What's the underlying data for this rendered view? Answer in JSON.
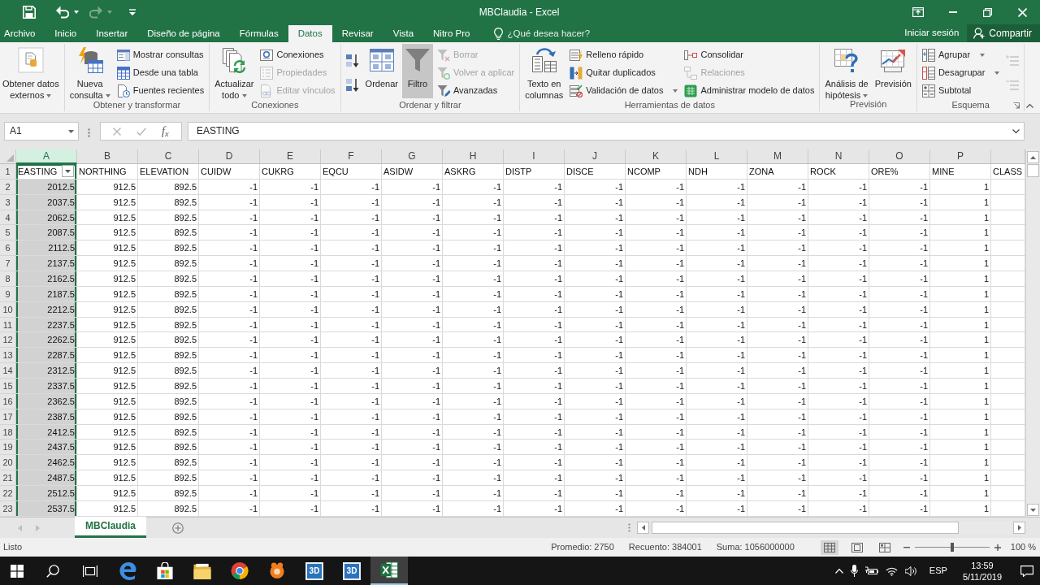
{
  "window": {
    "title": "MBClaudia - Excel"
  },
  "quick_access": [
    {
      "disabled": false
    },
    {
      "disabled": false
    },
    {
      "disabled": true
    },
    {
      "disabled": false
    }
  ],
  "tabs": [
    {
      "label": "Archivo",
      "selected": false
    },
    {
      "label": "Inicio",
      "selected": false
    },
    {
      "label": "Insertar",
      "selected": false
    },
    {
      "label": "Diseño de página",
      "selected": false
    },
    {
      "label": "Fórmulas",
      "selected": false
    },
    {
      "label": "Datos",
      "selected": true
    },
    {
      "label": "Revisar",
      "selected": false
    },
    {
      "label": "Vista",
      "selected": false
    },
    {
      "label": "Nitro Pro",
      "selected": false
    }
  ],
  "tell_me": {
    "placeholder": "¿Qué desea hacer?"
  },
  "account": {
    "sign_in": "Iniciar sesión",
    "share": "Compartir"
  },
  "ribbon": {
    "groups": [
      {
        "buttons": [
          {
            "kind": "large",
            "label": "Obtener datos\nexternos",
            "dropdown": true,
            "disabled": false,
            "selected": false
          }
        ]
      },
      {
        "label": "Obtener y transformar",
        "buttons": [
          {
            "kind": "large",
            "label": "Nueva\nconsulta",
            "dropdown": true,
            "disabled": false,
            "selected": false
          },
          {
            "kind": "small",
            "label": "Mostrar consultas",
            "dropdown": false,
            "disabled": false,
            "selected": false
          },
          {
            "kind": "small",
            "label": "Desde una tabla",
            "dropdown": false,
            "disabled": false,
            "selected": false
          },
          {
            "kind": "small",
            "label": "Fuentes recientes",
            "dropdown": false,
            "disabled": false,
            "selected": false
          }
        ]
      },
      {
        "label": "Conexiones",
        "buttons": [
          {
            "kind": "large",
            "label": "Actualizar\ntodo",
            "dropdown": true,
            "disabled": false,
            "selected": false
          },
          {
            "kind": "small",
            "label": "Conexiones",
            "dropdown": false,
            "disabled": false,
            "selected": false
          },
          {
            "kind": "small",
            "label": "Propiedades",
            "dropdown": false,
            "disabled": true,
            "selected": false
          },
          {
            "kind": "small",
            "label": "Editar vínculos",
            "dropdown": false,
            "disabled": true,
            "selected": false
          }
        ]
      },
      {
        "label": "Ordenar y filtrar",
        "buttons": [
          {
            "kind": "icon",
            "dropdown": false,
            "disabled": false,
            "selected": false
          },
          {
            "kind": "icon",
            "dropdown": false,
            "disabled": false,
            "selected": false
          },
          {
            "kind": "large",
            "label": "Ordenar",
            "dropdown": false,
            "disabled": false,
            "selected": false
          },
          {
            "kind": "large",
            "label": "Filtro",
            "dropdown": false,
            "disabled": false,
            "selected": true
          },
          {
            "kind": "small",
            "label": "Borrar",
            "dropdown": false,
            "disabled": true,
            "selected": false
          },
          {
            "kind": "small",
            "label": "Volver a aplicar",
            "dropdown": false,
            "disabled": true,
            "selected": false
          },
          {
            "kind": "small",
            "label": "Avanzadas",
            "dropdown": false,
            "disabled": false,
            "selected": false
          }
        ]
      },
      {
        "label": "Herramientas de datos",
        "buttons": [
          {
            "kind": "large",
            "label": "Texto en\ncolumnas",
            "dropdown": false,
            "disabled": false,
            "selected": false
          },
          {
            "kind": "small",
            "label": "Relleno rápido",
            "dropdown": false,
            "disabled": false,
            "selected": false
          },
          {
            "kind": "small",
            "label": "Quitar duplicados",
            "dropdown": false,
            "disabled": false,
            "selected": false
          },
          {
            "kind": "small",
            "label": "Validación de datos",
            "dropdown": true,
            "disabled": false,
            "selected": false
          },
          {
            "kind": "small",
            "label": "Consolidar",
            "dropdown": false,
            "disabled": false,
            "selected": false
          },
          {
            "kind": "small",
            "label": "Relaciones",
            "dropdown": false,
            "disabled": true,
            "selected": false
          },
          {
            "kind": "small",
            "label": "Administrar modelo de datos",
            "dropdown": false,
            "disabled": false,
            "selected": false
          }
        ]
      },
      {
        "label": "Previsión",
        "buttons": [
          {
            "kind": "large",
            "label": "Análisis de\nhipótesis",
            "dropdown": true,
            "disabled": false,
            "selected": false
          },
          {
            "kind": "large",
            "label": "Previsión",
            "dropdown": false,
            "disabled": false,
            "selected": false
          }
        ]
      },
      {
        "label": "Esquema",
        "launcher": true,
        "buttons": [
          {
            "kind": "small",
            "label": "Agrupar",
            "dropdown": true,
            "disabled": false,
            "selected": false
          },
          {
            "kind": "small",
            "label": "Desagrupar",
            "dropdown": true,
            "disabled": false,
            "selected": false
          },
          {
            "kind": "small",
            "label": "Subtotal",
            "dropdown": false,
            "disabled": false,
            "selected": false
          },
          {
            "kind": "icon",
            "dropdown": false,
            "disabled": true,
            "selected": false
          },
          {
            "kind": "icon",
            "dropdown": false,
            "disabled": true,
            "selected": false
          }
        ]
      }
    ]
  },
  "formula_bar": {
    "name_box": "A1",
    "insert_function": "f$_{x}$",
    "formula": "EASTING"
  },
  "sheet": {
    "columns": [
      {
        "letter": "A",
        "selected": true,
        "filter": true
      },
      {
        "letter": "B",
        "selected": false,
        "filter": false
      },
      {
        "letter": "C",
        "selected": false,
        "filter": false
      },
      {
        "letter": "D",
        "selected": false,
        "filter": false
      },
      {
        "letter": "E",
        "selected": false,
        "filter": false
      },
      {
        "letter": "F",
        "selected": false,
        "filter": false
      },
      {
        "letter": "G",
        "selected": false,
        "filter": false
      },
      {
        "letter": "H",
        "selected": false,
        "filter": false
      },
      {
        "letter": "I",
        "selected": false,
        "filter": false
      },
      {
        "letter": "J",
        "selected": false,
        "filter": false
      },
      {
        "letter": "K",
        "selected": false,
        "filter": false
      },
      {
        "letter": "L",
        "selected": false,
        "filter": false
      },
      {
        "letter": "M",
        "selected": false,
        "filter": false
      },
      {
        "letter": "N",
        "selected": false,
        "filter": false
      },
      {
        "letter": "O",
        "selected": false,
        "filter": false
      },
      {
        "letter": "P",
        "selected": false,
        "filter": false
      }
    ],
    "rows": [
      {
        "number": "1",
        "cells": [
          "EASTING",
          "NORTHING",
          "ELEVATION",
          "CUIDW",
          "CUKRG",
          "EQCU",
          "ASIDW",
          "ASKRG",
          "DISTP",
          "DISCE",
          "NCOMP",
          "NDH",
          "ZONA",
          "ROCK",
          "ORE%",
          "MINE",
          "CLASS"
        ]
      },
      {
        "number": "2",
        "cells": [
          "2012.5",
          "912.5",
          "892.5",
          "-1",
          "-1",
          "-1",
          "-1",
          "-1",
          "-1",
          "-1",
          "-1",
          "-1",
          "-1",
          "-1",
          "-1",
          "1"
        ]
      },
      {
        "number": "3",
        "cells": [
          "2037.5",
          "912.5",
          "892.5",
          "-1",
          "-1",
          "-1",
          "-1",
          "-1",
          "-1",
          "-1",
          "-1",
          "-1",
          "-1",
          "-1",
          "-1",
          "1"
        ]
      },
      {
        "number": "4",
        "cells": [
          "2062.5",
          "912.5",
          "892.5",
          "-1",
          "-1",
          "-1",
          "-1",
          "-1",
          "-1",
          "-1",
          "-1",
          "-1",
          "-1",
          "-1",
          "-1",
          "1"
        ]
      },
      {
        "number": "5",
        "cells": [
          "2087.5",
          "912.5",
          "892.5",
          "-1",
          "-1",
          "-1",
          "-1",
          "-1",
          "-1",
          "-1",
          "-1",
          "-1",
          "-1",
          "-1",
          "-1",
          "1"
        ]
      },
      {
        "number": "6",
        "cells": [
          "2112.5",
          "912.5",
          "892.5",
          "-1",
          "-1",
          "-1",
          "-1",
          "-1",
          "-1",
          "-1",
          "-1",
          "-1",
          "-1",
          "-1",
          "-1",
          "1"
        ]
      },
      {
        "number": "7",
        "cells": [
          "2137.5",
          "912.5",
          "892.5",
          "-1",
          "-1",
          "-1",
          "-1",
          "-1",
          "-1",
          "-1",
          "-1",
          "-1",
          "-1",
          "-1",
          "-1",
          "1"
        ]
      },
      {
        "number": "8",
        "cells": [
          "2162.5",
          "912.5",
          "892.5",
          "-1",
          "-1",
          "-1",
          "-1",
          "-1",
          "-1",
          "-1",
          "-1",
          "-1",
          "-1",
          "-1",
          "-1",
          "1"
        ]
      },
      {
        "number": "9",
        "cells": [
          "2187.5",
          "912.5",
          "892.5",
          "-1",
          "-1",
          "-1",
          "-1",
          "-1",
          "-1",
          "-1",
          "-1",
          "-1",
          "-1",
          "-1",
          "-1",
          "1"
        ]
      },
      {
        "number": "10",
        "cells": [
          "2212.5",
          "912.5",
          "892.5",
          "-1",
          "-1",
          "-1",
          "-1",
          "-1",
          "-1",
          "-1",
          "-1",
          "-1",
          "-1",
          "-1",
          "-1",
          "1"
        ]
      },
      {
        "number": "11",
        "cells": [
          "2237.5",
          "912.5",
          "892.5",
          "-1",
          "-1",
          "-1",
          "-1",
          "-1",
          "-1",
          "-1",
          "-1",
          "-1",
          "-1",
          "-1",
          "-1",
          "1"
        ]
      },
      {
        "number": "12",
        "cells": [
          "2262.5",
          "912.5",
          "892.5",
          "-1",
          "-1",
          "-1",
          "-1",
          "-1",
          "-1",
          "-1",
          "-1",
          "-1",
          "-1",
          "-1",
          "-1",
          "1"
        ]
      },
      {
        "number": "13",
        "cells": [
          "2287.5",
          "912.5",
          "892.5",
          "-1",
          "-1",
          "-1",
          "-1",
          "-1",
          "-1",
          "-1",
          "-1",
          "-1",
          "-1",
          "-1",
          "-1",
          "1"
        ]
      },
      {
        "number": "14",
        "cells": [
          "2312.5",
          "912.5",
          "892.5",
          "-1",
          "-1",
          "-1",
          "-1",
          "-1",
          "-1",
          "-1",
          "-1",
          "-1",
          "-1",
          "-1",
          "-1",
          "1"
        ]
      },
      {
        "number": "15",
        "cells": [
          "2337.5",
          "912.5",
          "892.5",
          "-1",
          "-1",
          "-1",
          "-1",
          "-1",
          "-1",
          "-1",
          "-1",
          "-1",
          "-1",
          "-1",
          "-1",
          "1"
        ]
      },
      {
        "number": "16",
        "cells": [
          "2362.5",
          "912.5",
          "892.5",
          "-1",
          "-1",
          "-1",
          "-1",
          "-1",
          "-1",
          "-1",
          "-1",
          "-1",
          "-1",
          "-1",
          "-1",
          "1"
        ]
      },
      {
        "number": "17",
        "cells": [
          "2387.5",
          "912.5",
          "892.5",
          "-1",
          "-1",
          "-1",
          "-1",
          "-1",
          "-1",
          "-1",
          "-1",
          "-1",
          "-1",
          "-1",
          "-1",
          "1"
        ]
      },
      {
        "number": "18",
        "cells": [
          "2412.5",
          "912.5",
          "892.5",
          "-1",
          "-1",
          "-1",
          "-1",
          "-1",
          "-1",
          "-1",
          "-1",
          "-1",
          "-1",
          "-1",
          "-1",
          "1"
        ]
      },
      {
        "number": "19",
        "cells": [
          "2437.5",
          "912.5",
          "892.5",
          "-1",
          "-1",
          "-1",
          "-1",
          "-1",
          "-1",
          "-1",
          "-1",
          "-1",
          "-1",
          "-1",
          "-1",
          "1"
        ]
      },
      {
        "number": "20",
        "cells": [
          "2462.5",
          "912.5",
          "892.5",
          "-1",
          "-1",
          "-1",
          "-1",
          "-1",
          "-1",
          "-1",
          "-1",
          "-1",
          "-1",
          "-1",
          "-1",
          "1"
        ]
      },
      {
        "number": "21",
        "cells": [
          "2487.5",
          "912.5",
          "892.5",
          "-1",
          "-1",
          "-1",
          "-1",
          "-1",
          "-1",
          "-1",
          "-1",
          "-1",
          "-1",
          "-1",
          "-1",
          "1"
        ]
      },
      {
        "number": "22",
        "cells": [
          "2512.5",
          "912.5",
          "892.5",
          "-1",
          "-1",
          "-1",
          "-1",
          "-1",
          "-1",
          "-1",
          "-1",
          "-1",
          "-1",
          "-1",
          "-1",
          "1"
        ]
      },
      {
        "number": "23",
        "cells": [
          "2537.5",
          "912.5",
          "892.5",
          "-1",
          "-1",
          "-1",
          "-1",
          "-1",
          "-1",
          "-1",
          "-1",
          "-1",
          "-1",
          "-1",
          "-1",
          "1"
        ]
      }
    ]
  },
  "sheet_tabs": [
    {
      "label": "MBClaudia",
      "selected": true
    }
  ],
  "status_bar": {
    "status": "Listo",
    "stats": [
      "Promedio: 2750",
      "Recuento: 384001",
      "Suma: 1056000000"
    ],
    "views": [
      {
        "selected": true
      },
      {
        "selected": false
      },
      {
        "selected": false
      }
    ],
    "zoom": {
      "level": 0.5,
      "reading": "100 %"
    }
  },
  "taskbar": {
    "apps": [
      {
        "selected": false
      },
      {
        "selected": false
      },
      {
        "selected": false
      },
      {
        "selected": false
      },
      {
        "selected": false
      },
      {
        "label": "3D",
        "selected": false
      },
      {
        "label": "3D",
        "selected": false
      },
      {
        "selected": true
      }
    ],
    "language": "ESP",
    "time": "13:59",
    "date": "5/11/2019"
  }
}
